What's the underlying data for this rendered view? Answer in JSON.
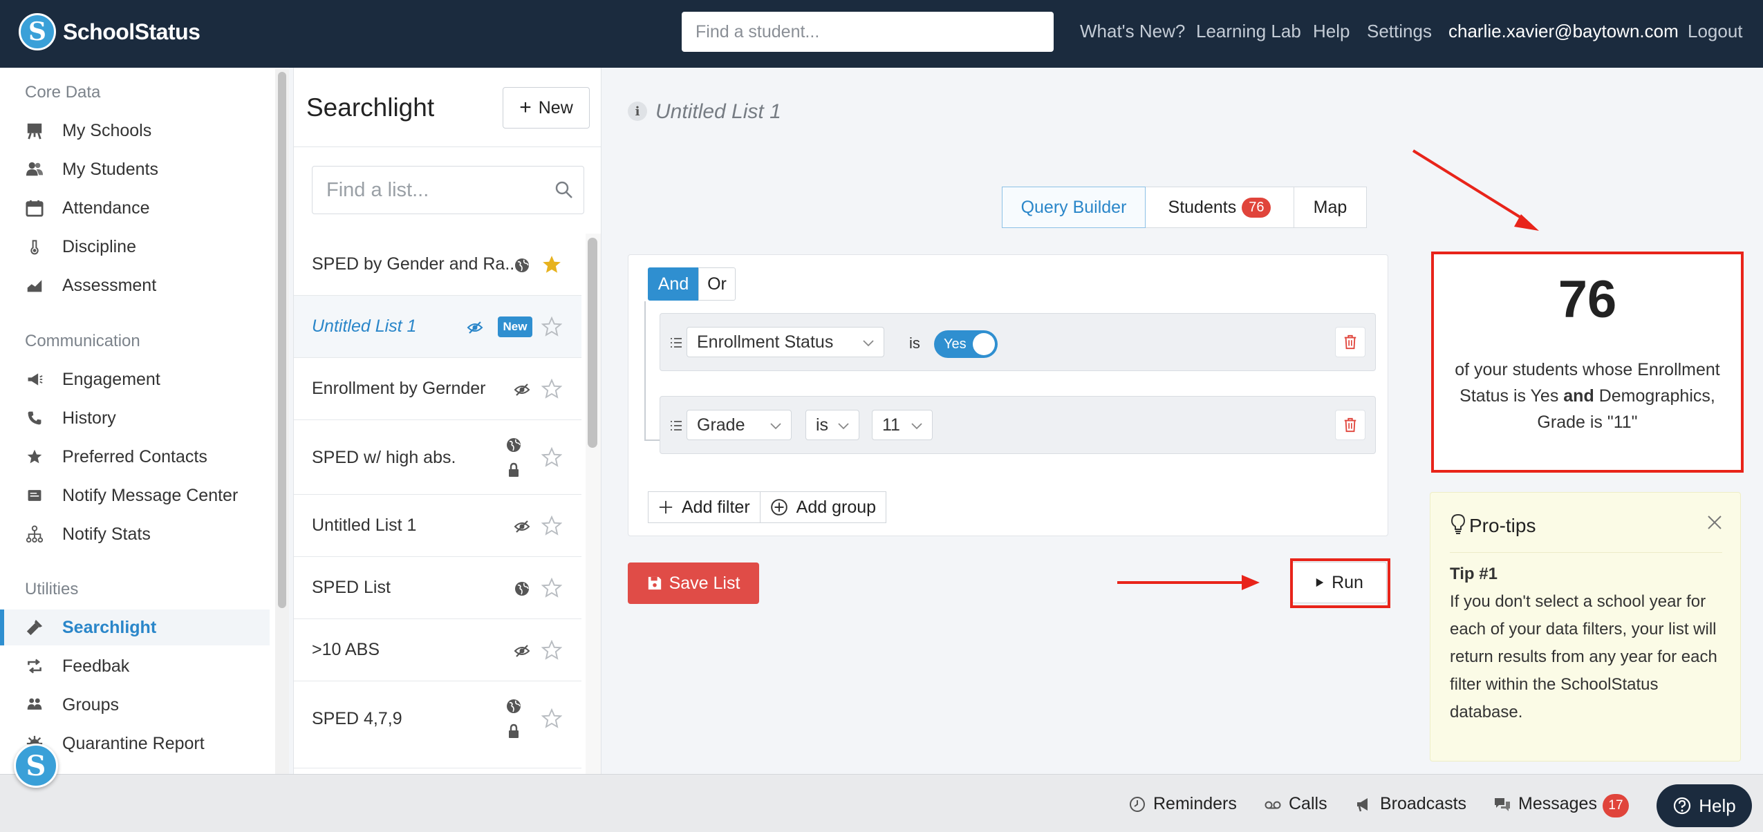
{
  "app": {
    "name": "SchoolStatus"
  },
  "topbar": {
    "search_placeholder": "Find a student...",
    "links": [
      "What's New?",
      "Learning Lab",
      "Help",
      "Settings"
    ],
    "user_email": "charlie.xavier@baytown.com",
    "logout": "Logout"
  },
  "sidebar": {
    "sections": [
      {
        "title": "Core Data",
        "items": [
          {
            "label": "My Schools",
            "icon": "easel-icon"
          },
          {
            "label": "My Students",
            "icon": "users-icon"
          },
          {
            "label": "Attendance",
            "icon": "calendar-icon"
          },
          {
            "label": "Discipline",
            "icon": "thermometer-icon"
          },
          {
            "label": "Assessment",
            "icon": "area-chart-icon"
          }
        ]
      },
      {
        "title": "Communication",
        "items": [
          {
            "label": "Engagement",
            "icon": "megaphone-icon"
          },
          {
            "label": "History",
            "icon": "phone-icon"
          },
          {
            "label": "Preferred Contacts",
            "icon": "star-icon"
          },
          {
            "label": "Notify Message Center",
            "icon": "message-card-icon"
          },
          {
            "label": "Notify Stats",
            "icon": "sitemap-icon"
          }
        ]
      },
      {
        "title": "Utilities",
        "items": [
          {
            "label": "Searchlight",
            "icon": "flashlight-icon",
            "active": true
          },
          {
            "label": "Feedbak",
            "icon": "retweet-icon"
          },
          {
            "label": "Groups",
            "icon": "groups-icon"
          },
          {
            "label": "Quarantine Report",
            "icon": "virus-icon"
          }
        ]
      }
    ]
  },
  "lists_panel": {
    "title": "Searchlight",
    "new_button": "New",
    "search_placeholder": "Find a list...",
    "items": [
      {
        "name": "SPED by Gender and Ra...",
        "visibility": "globe",
        "starred": true
      },
      {
        "name": "Untitled List 1",
        "visibility": "eye-slash",
        "badge": "New",
        "selected": true
      },
      {
        "name": "Enrollment by Gernder",
        "visibility": "eye-slash"
      },
      {
        "name": "SPED w/ high abs.",
        "visibility": "globe-lock"
      },
      {
        "name": "Untitled List 1",
        "visibility": "eye-slash"
      },
      {
        "name": "SPED List",
        "visibility": "globe"
      },
      {
        "name": ">10 ABS",
        "visibility": "eye-slash"
      },
      {
        "name": "SPED 4,7,9",
        "visibility": "globe-lock"
      }
    ]
  },
  "main": {
    "title": "Untitled List 1",
    "tabs": [
      {
        "label": "Query Builder",
        "active": true
      },
      {
        "label": "Students",
        "count": "76"
      },
      {
        "label": "Map"
      }
    ],
    "logic": {
      "and": "And",
      "or": "Or",
      "selected": "And"
    },
    "filters": [
      {
        "field": "Enrollment Status",
        "operator": "is",
        "value": "Yes"
      },
      {
        "field": "Grade",
        "operator": "is",
        "value": "11"
      }
    ],
    "add_filter": "Add filter",
    "add_group": "Add group",
    "save_button": "Save List",
    "run_button": "Run"
  },
  "result": {
    "count": "76",
    "desc_part1": "of your students whose Enrollment Status is Yes",
    "desc_and": "and",
    "desc_part2": "Demographics, Grade is \"11\""
  },
  "pro_tips": {
    "title": "Pro-tips",
    "tip_title": "Tip #1",
    "tip_text": "If you don't select a school year for each of your data filters, your list will return results from any year for each filter within the SchoolStatus database."
  },
  "bottom_bar": {
    "reminders": "Reminders",
    "calls": "Calls",
    "broadcasts": "Broadcasts",
    "messages": "Messages",
    "messages_count": "17",
    "help": "Help"
  },
  "colors": {
    "topbar": "#1b2b3e",
    "accent": "#2f8fd0",
    "danger": "#e04c47",
    "annotation": "#e8241a",
    "tips_bg": "#fbfbe6"
  }
}
